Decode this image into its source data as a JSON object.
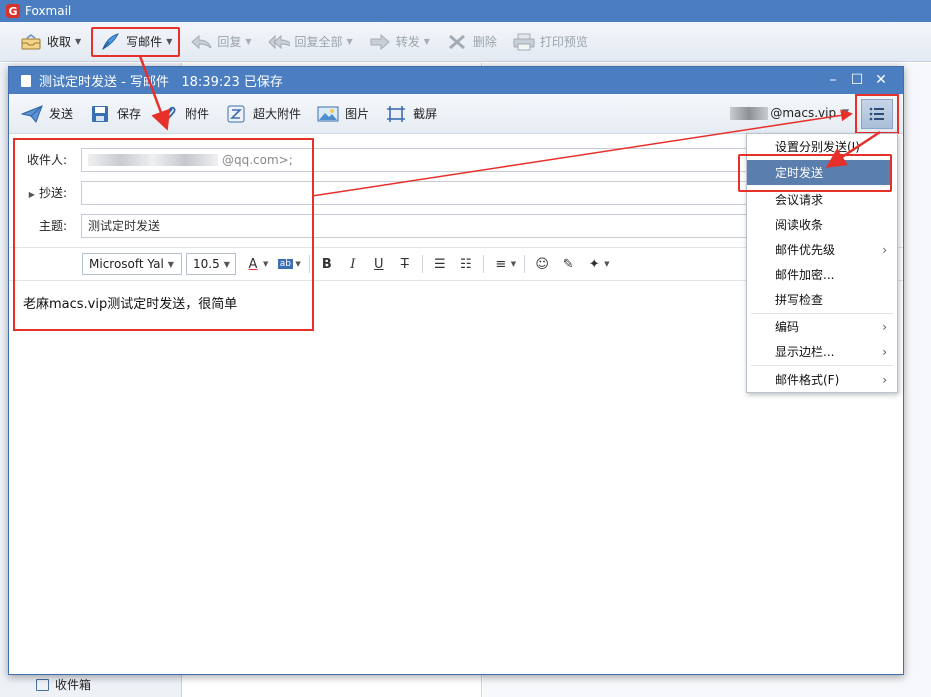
{
  "app": {
    "title": "Foxmail",
    "logo_letter": "G"
  },
  "main_toolbar": {
    "receive": "收取",
    "compose": "写邮件",
    "reply": "回复",
    "reply_all": "回复全部",
    "forward": "转发",
    "delete": "删除",
    "print_preview": "打印预览"
  },
  "folders": {
    "inbox": "收件箱"
  },
  "compose_window": {
    "title": "测试定时发送 - 写邮件",
    "time": "18:39:23",
    "status": "已保存",
    "toolbar": {
      "send": "发送",
      "save": "保存",
      "attach": "附件",
      "large_attach": "超大附件",
      "image": "图片",
      "screenshot": "截屏"
    },
    "account": "@macs.vip",
    "fields": {
      "to_label": "收件人:",
      "to_value_suffix": "@qq.com>;",
      "cc_label": "抄送:",
      "cc_value": "",
      "subject_label": "主题:",
      "subject_value": "测试定时发送"
    },
    "format": {
      "font": "Microsoft Yal",
      "size": "10.5"
    },
    "body": "老麻macs.vip测试定时发送，很简单"
  },
  "more_menu": {
    "items": [
      {
        "label": "设置分别发送(I)",
        "submenu": false
      },
      {
        "label": "定时发送",
        "submenu": false,
        "active": true
      },
      {
        "label": "会议请求",
        "submenu": false
      },
      {
        "label": "阅读收条",
        "submenu": false
      },
      {
        "label": "邮件优先级",
        "submenu": true
      },
      {
        "label": "邮件加密...",
        "submenu": false
      },
      {
        "label": "拼写检查",
        "submenu": false
      },
      {
        "label": "编码",
        "submenu": true
      },
      {
        "label": "显示边栏...",
        "submenu": true
      },
      {
        "label": "邮件格式(F)",
        "submenu": true
      }
    ]
  },
  "colors": {
    "titlebar": "#4a7ec0",
    "annotation_red": "#e8302a",
    "menu_active": "#5a7fae"
  }
}
